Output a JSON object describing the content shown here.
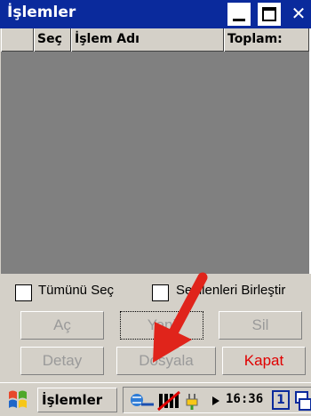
{
  "window": {
    "title": "İşlemler",
    "close_glyph": "✕"
  },
  "list": {
    "columns": [
      "",
      "Seç",
      "İşlem Adı",
      "Toplam:"
    ]
  },
  "options": {
    "select_all": "Tümünü Seç",
    "merge_selected": "Seçilenleri Birleştir"
  },
  "buttons": {
    "open": "Aç",
    "new": "Yeni",
    "delete": "Sil",
    "detail": "Detay",
    "file": "Dosyala",
    "close": "Kapat"
  },
  "taskbar": {
    "task": "İşlemler",
    "time": "16:36",
    "input_num": "1"
  },
  "colors": {
    "title_bg": "#0a2a9c",
    "list_bg": "#808080",
    "close_text": "#e00000",
    "arrow": "#e0241b"
  }
}
